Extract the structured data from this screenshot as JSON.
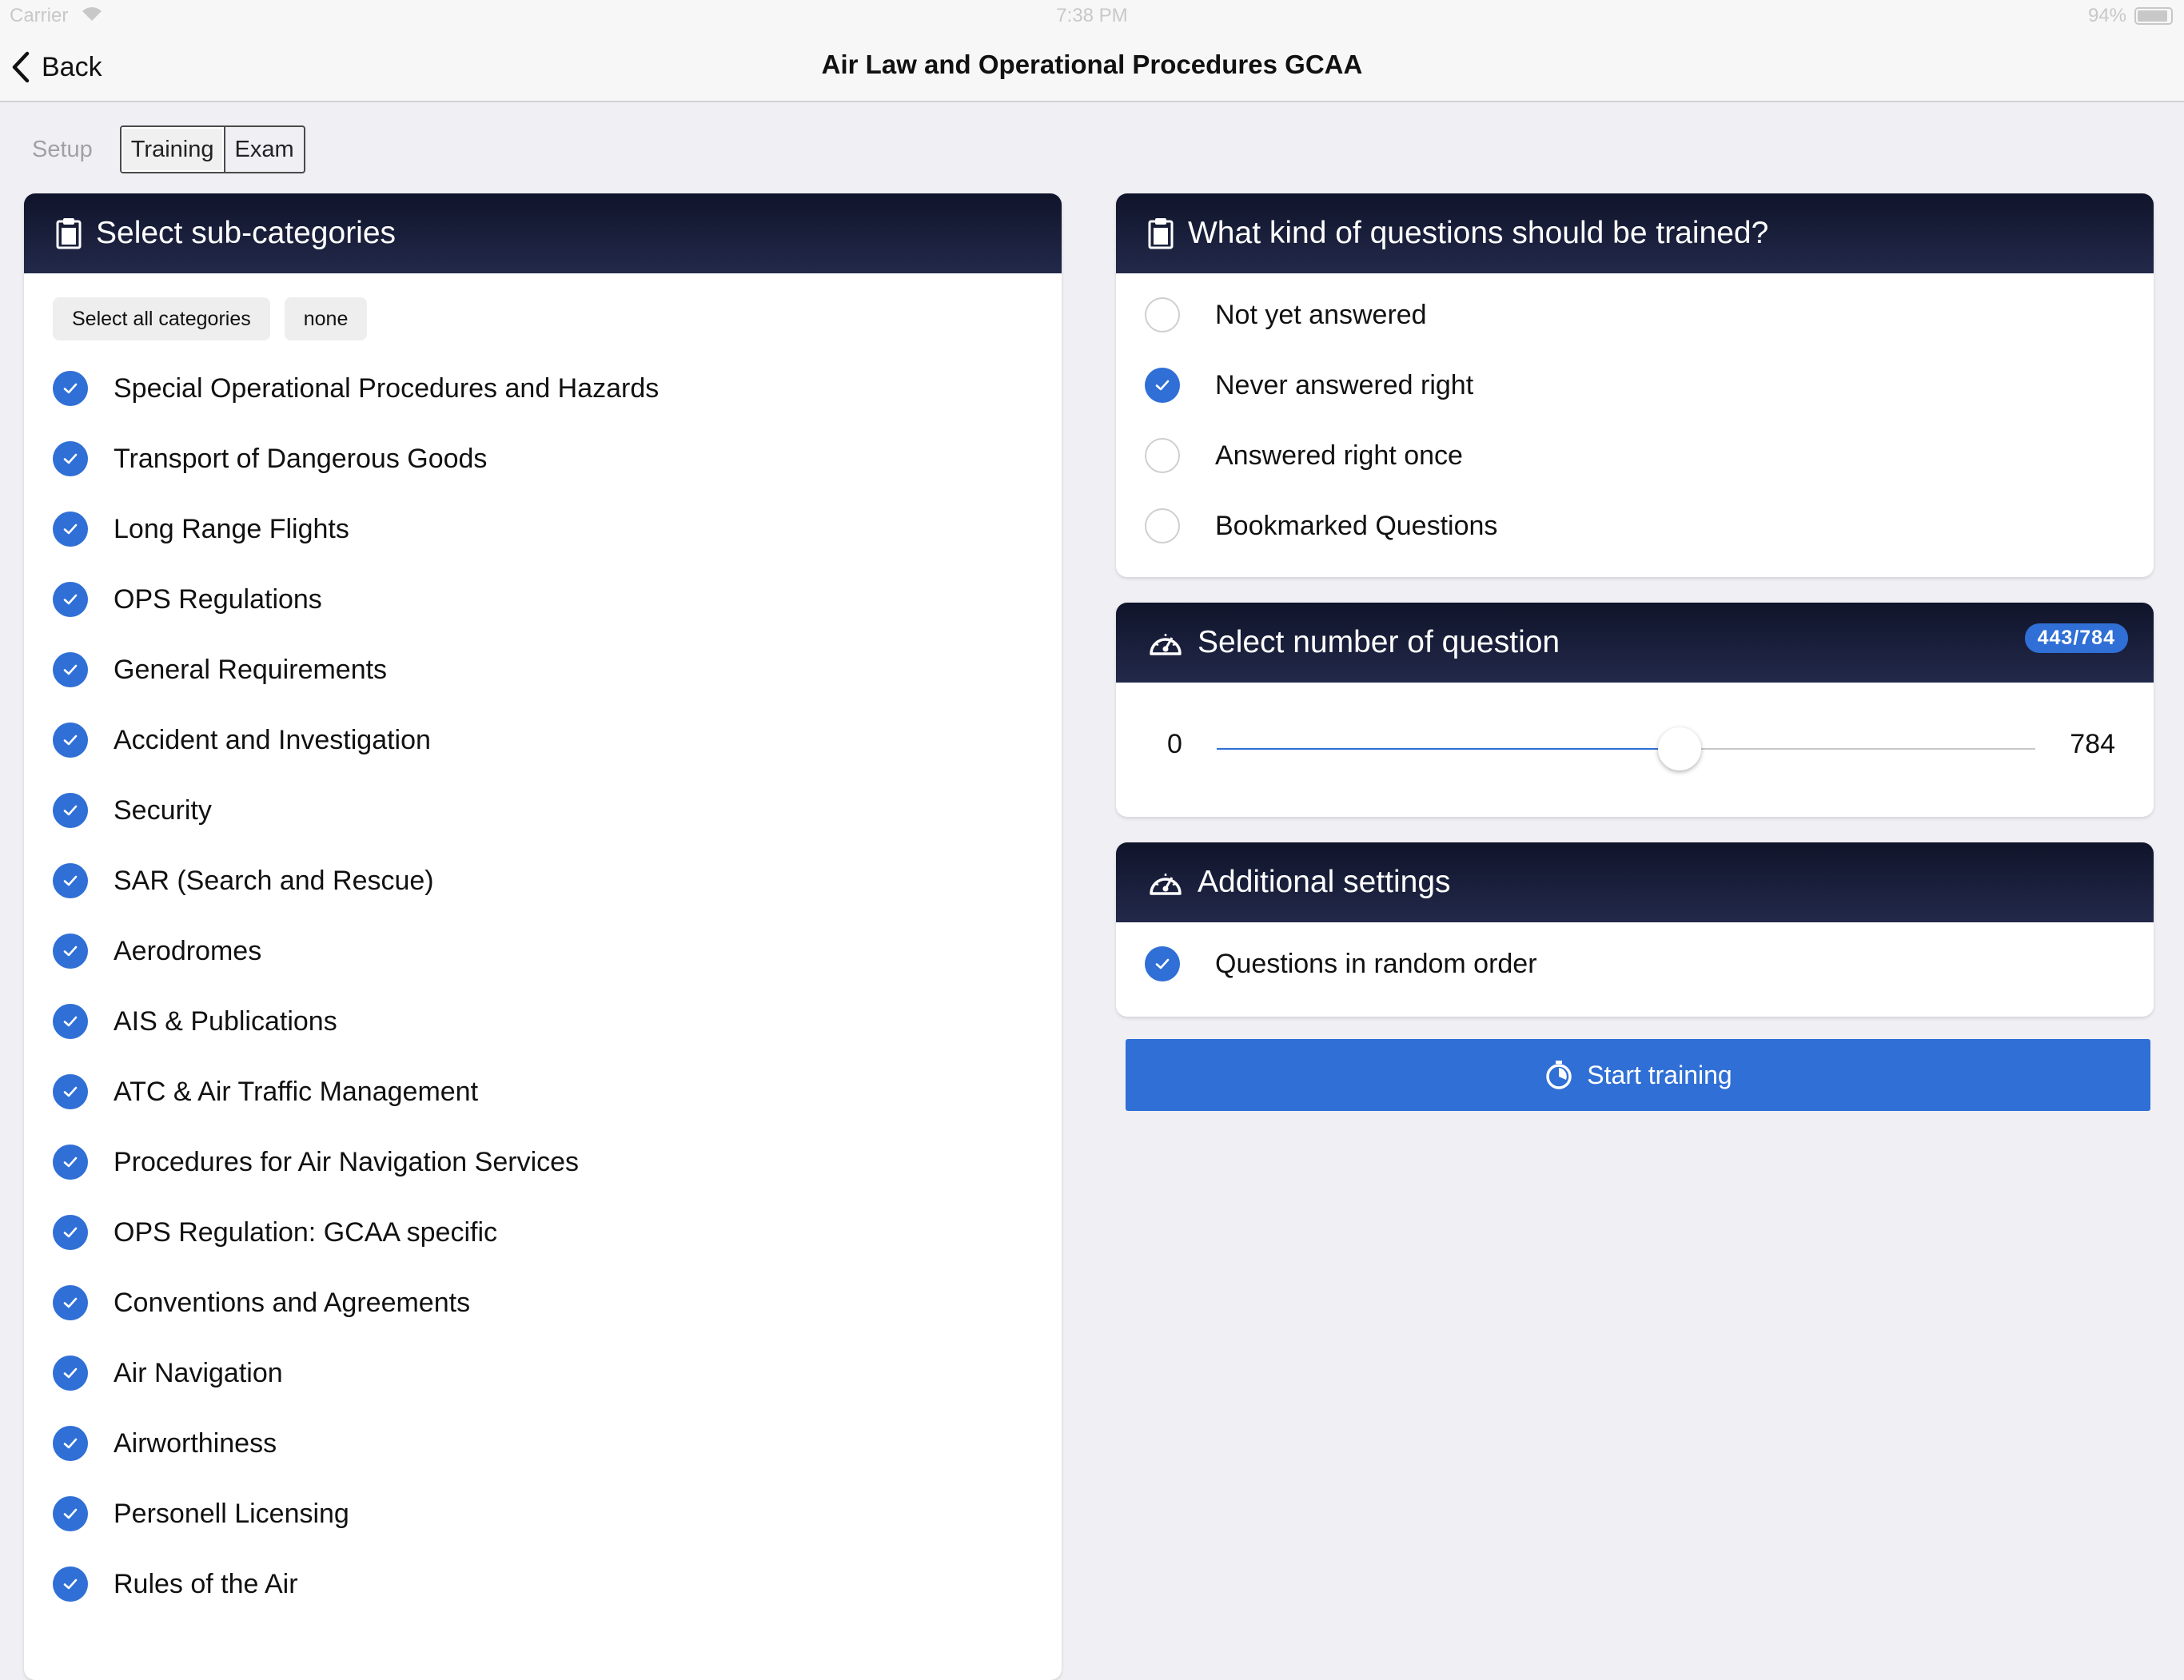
{
  "status_bar": {
    "carrier": "Carrier",
    "time": "7:38 PM",
    "battery": "94%"
  },
  "nav": {
    "back_label": "Back",
    "title": "Air Law and Operational Procedures GCAA"
  },
  "mode": {
    "setup_label": "Setup",
    "tabs": [
      "Training",
      "Exam"
    ],
    "active_tab": "Training"
  },
  "subcategories": {
    "title": "Select sub-categories",
    "select_all_label": "Select all categories",
    "none_label": "none",
    "items": [
      {
        "label": "Special Operational Procedures and Hazards",
        "checked": true
      },
      {
        "label": "Transport of Dangerous Goods",
        "checked": true
      },
      {
        "label": "Long Range Flights",
        "checked": true
      },
      {
        "label": "OPS Regulations",
        "checked": true
      },
      {
        "label": "General Requirements",
        "checked": true
      },
      {
        "label": "Accident and Investigation",
        "checked": true
      },
      {
        "label": "Security",
        "checked": true
      },
      {
        "label": "SAR (Search and Rescue)",
        "checked": true
      },
      {
        "label": "Aerodromes",
        "checked": true
      },
      {
        "label": "AIS & Publications",
        "checked": true
      },
      {
        "label": "ATC & Air Traffic Management",
        "checked": true
      },
      {
        "label": "Procedures for Air Navigation Services",
        "checked": true
      },
      {
        "label": "OPS Regulation: GCAA specific",
        "checked": true
      },
      {
        "label": "Conventions and Agreements",
        "checked": true
      },
      {
        "label": "Air Navigation",
        "checked": true
      },
      {
        "label": "Airworthiness",
        "checked": true
      },
      {
        "label": "Personell Licensing",
        "checked": true
      },
      {
        "label": "Rules of the Air",
        "checked": true
      }
    ]
  },
  "question_kinds": {
    "title": "What kind of questions should be trained?",
    "options": [
      {
        "label": "Not yet answered",
        "checked": false
      },
      {
        "label": "Never answered right",
        "checked": true
      },
      {
        "label": "Answered right once",
        "checked": false
      },
      {
        "label": "Bookmarked Questions",
        "checked": false
      }
    ]
  },
  "question_count": {
    "title": "Select number of question",
    "badge": "443/784",
    "min_label": "0",
    "max_label": "784",
    "min": 0,
    "max": 784,
    "value": 443
  },
  "additional": {
    "title": "Additional settings",
    "options": [
      {
        "label": "Questions in random order",
        "checked": true
      }
    ]
  },
  "start_label": "Start training",
  "colors": {
    "accent": "#2f6fd6",
    "header_dark": "#161b33",
    "background": "#efeff4"
  }
}
